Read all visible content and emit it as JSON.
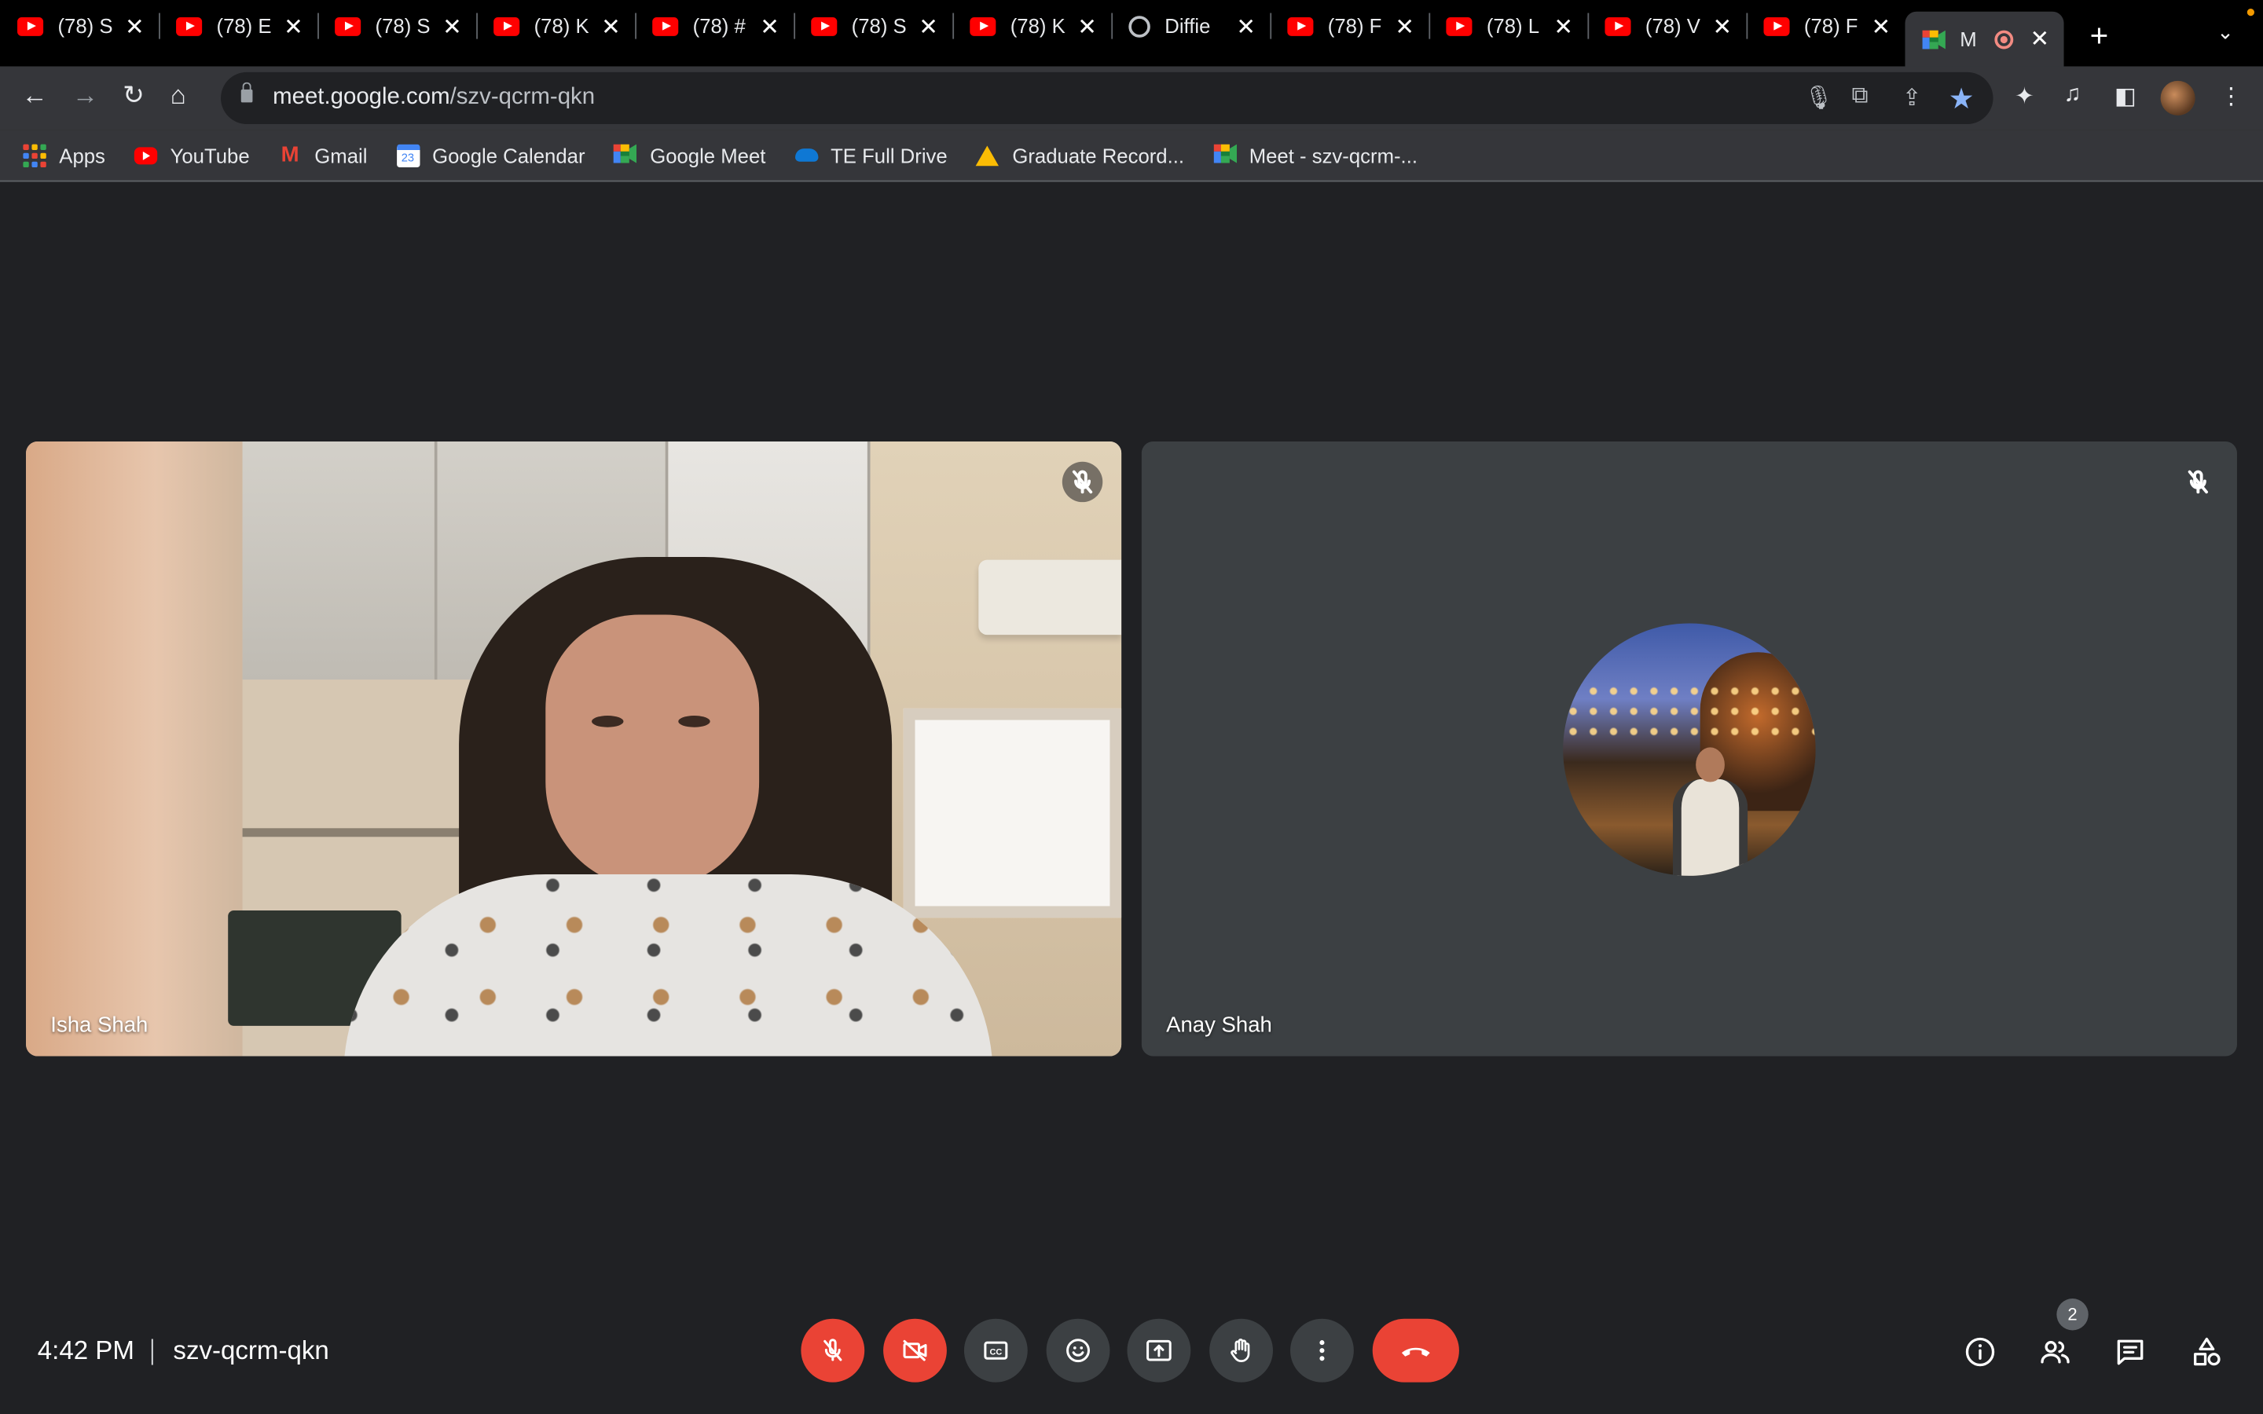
{
  "browser": {
    "tabs": [
      {
        "title": "(78) S",
        "icon": "youtube-icon"
      },
      {
        "title": "(78) E",
        "icon": "youtube-icon"
      },
      {
        "title": "(78) S",
        "icon": "youtube-icon"
      },
      {
        "title": "(78) K",
        "icon": "youtube-icon"
      },
      {
        "title": "(78) #",
        "icon": "youtube-icon"
      },
      {
        "title": "(78) S",
        "icon": "youtube-icon"
      },
      {
        "title": "(78) K",
        "icon": "youtube-icon"
      },
      {
        "title": "Diffie",
        "icon": "globe-icon"
      },
      {
        "title": "(78) F",
        "icon": "youtube-icon"
      },
      {
        "title": "(78) L",
        "icon": "youtube-icon"
      },
      {
        "title": "(78) V",
        "icon": "youtube-icon"
      },
      {
        "title": "(78) F",
        "icon": "youtube-icon"
      },
      {
        "title": "M",
        "icon": "google-meet-icon",
        "active": true,
        "recording": true
      }
    ],
    "url_host": "meet.google.com",
    "url_path": "/szv-qcrm-qkn",
    "bookmarks": [
      {
        "label": "Apps",
        "icon": "apps-grid-icon"
      },
      {
        "label": "YouTube",
        "icon": "youtube-icon"
      },
      {
        "label": "Gmail",
        "icon": "gmail-icon"
      },
      {
        "label": "Google Calendar",
        "icon": "google-calendar-icon"
      },
      {
        "label": "Google Meet",
        "icon": "google-meet-icon"
      },
      {
        "label": "TE Full Drive",
        "icon": "onedrive-icon"
      },
      {
        "label": "Graduate Record...",
        "icon": "google-drive-icon"
      },
      {
        "label": "Meet - szv-qcrm-...",
        "icon": "google-meet-icon"
      }
    ],
    "calendar_day": "23"
  },
  "meet": {
    "participants": [
      {
        "name": "Isha Shah",
        "muted": true,
        "camera_on": true
      },
      {
        "name": "Anay Shah",
        "muted": true,
        "camera_on": false
      }
    ],
    "time": "4:42 PM",
    "code": "szv-qcrm-qkn",
    "people_count": "2",
    "colors": {
      "background": "#202124",
      "tile": "#3c4043",
      "danger": "#ea4335"
    }
  }
}
